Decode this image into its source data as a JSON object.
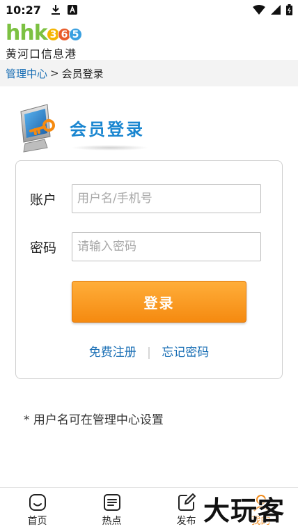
{
  "status_bar": {
    "time": "10:27",
    "icons": [
      "download-icon",
      "a-icon",
      "wifi-icon",
      "signal-icon",
      "battery-icon"
    ]
  },
  "header": {
    "logo_letters": "hhk",
    "logo_digits": [
      "3",
      "6",
      "5"
    ],
    "logo_sub": "黄河口信息港"
  },
  "breadcrumb": {
    "link": "管理中心",
    "separator": ">",
    "current": "会员登录"
  },
  "title": "会员登录",
  "form": {
    "account_label": "账户",
    "account_placeholder": "用户名/手机号",
    "password_label": "密码",
    "password_placeholder": "请输入密码",
    "login_button": "登录",
    "register_link": "免费注册",
    "link_divider": "|",
    "forgot_link": "忘记密码"
  },
  "note": "* 用户名可在管理中心设置",
  "bottom_nav": {
    "items": [
      {
        "label": "首页",
        "icon": "home-icon"
      },
      {
        "label": "热点",
        "icon": "news-icon"
      },
      {
        "label": "发布",
        "icon": "edit-icon"
      },
      {
        "label": "我的",
        "icon": "user-icon"
      }
    ],
    "active_index": 3,
    "active_color": "#f08a1a"
  },
  "watermark": "大玩客",
  "colors": {
    "accent_blue": "#1a86d0",
    "link_blue": "#1a6fb5",
    "button_orange": "#f58a10",
    "logo_green": "#7cc142"
  }
}
